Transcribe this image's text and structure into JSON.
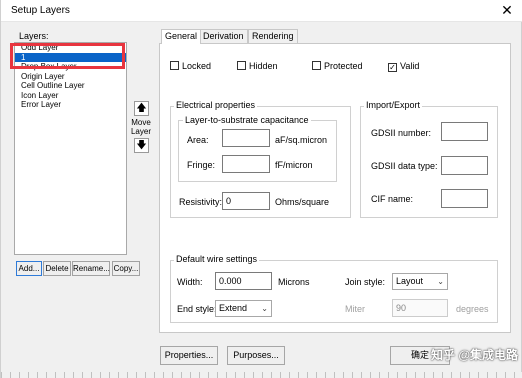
{
  "window": {
    "title": "Setup Layers"
  },
  "layers": {
    "label": "Layers:",
    "items": [
      "Odd Layer",
      "1",
      "Drop Box Layer",
      "Origin Layer",
      "Cell Outline Layer",
      "Icon Layer",
      "Error Layer"
    ],
    "selected_index": 1
  },
  "move": {
    "label": "Move Layer"
  },
  "layer_buttons": {
    "add": "Add...",
    "delete": "Delete",
    "rename": "Rename...",
    "copy": "Copy..."
  },
  "tabs": [
    "General",
    "Derivation",
    "Rendering"
  ],
  "checkboxes": [
    {
      "label": "Locked",
      "checked": false
    },
    {
      "label": "Hidden",
      "checked": false
    },
    {
      "label": "Protected",
      "checked": false
    },
    {
      "label": "Valid",
      "checked": true
    }
  ],
  "electrical": {
    "title": "Electrical properties",
    "substrate_title": "Layer-to-substrate capacitance",
    "area_label": "Area:",
    "area_unit": "aF/sq.micron",
    "fringe_label": "Fringe:",
    "fringe_unit": "fF/micron",
    "resistivity_label": "Resistivity:",
    "resistivity_value": "0",
    "resistivity_unit": "Ohms/square"
  },
  "import_export": {
    "title": "Import/Export",
    "gdsii_number_label": "GDSII number:",
    "gdsii_type_label": "GDSII data type:",
    "cif_label": "CIF name:"
  },
  "wire": {
    "title": "Default wire settings",
    "width_label": "Width:",
    "width_value": "0.000",
    "width_unit": "Microns",
    "join_label": "Join style:",
    "join_value": "Layout",
    "end_label": "End style:",
    "end_value": "Extend",
    "miter_label": "Miter",
    "miter_value": "90",
    "miter_unit": "degrees"
  },
  "footer": {
    "properties": "Properties...",
    "purposes": "Purposes...",
    "ok": "确定",
    "watermark": "知乎 @集成电路"
  },
  "colors": {
    "selection": "#0a64c8",
    "highlight": "#e8353f"
  }
}
